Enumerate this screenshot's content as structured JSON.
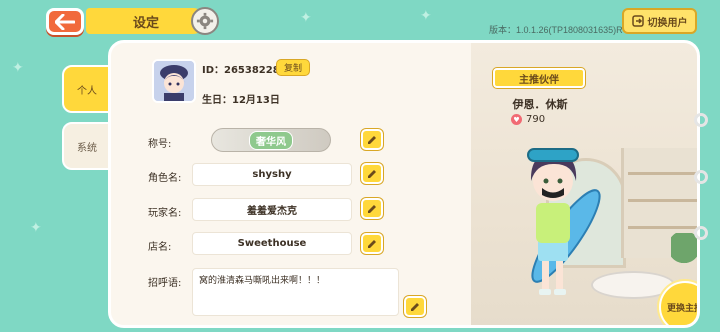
{
  "header": {
    "title": "设定",
    "version": "版本：1.0.1.26(TP1808031635)R",
    "switch_user": "切换用户"
  },
  "tabs": [
    {
      "label": "个人",
      "active": true
    },
    {
      "label": "系统",
      "active": false
    }
  ],
  "profile": {
    "id_text": "ID：26538228",
    "copy_label": "复制",
    "birthday": "生日：12月13日"
  },
  "fields": {
    "title_label": "称号:",
    "title_badge": "奢华风",
    "role_label": "角色名:",
    "role_value": "shyshy",
    "player_label": "玩家名:",
    "player_value": "羞羞爱杰克",
    "shop_label": "店名:",
    "shop_value": "Sweethouse",
    "greeting_label": "招呼语:",
    "greeting_value": "窝的淮清森马嘶吼出来啊！！！"
  },
  "partner": {
    "ribbon": "主推伙伴",
    "name": "伊恩．休斯",
    "affinity": "790",
    "change_label": "更换主推"
  },
  "colors": {
    "accent_yellow": "#ffd83b",
    "back_orange": "#f16a3c",
    "background_mint": "#7fd8c4"
  }
}
